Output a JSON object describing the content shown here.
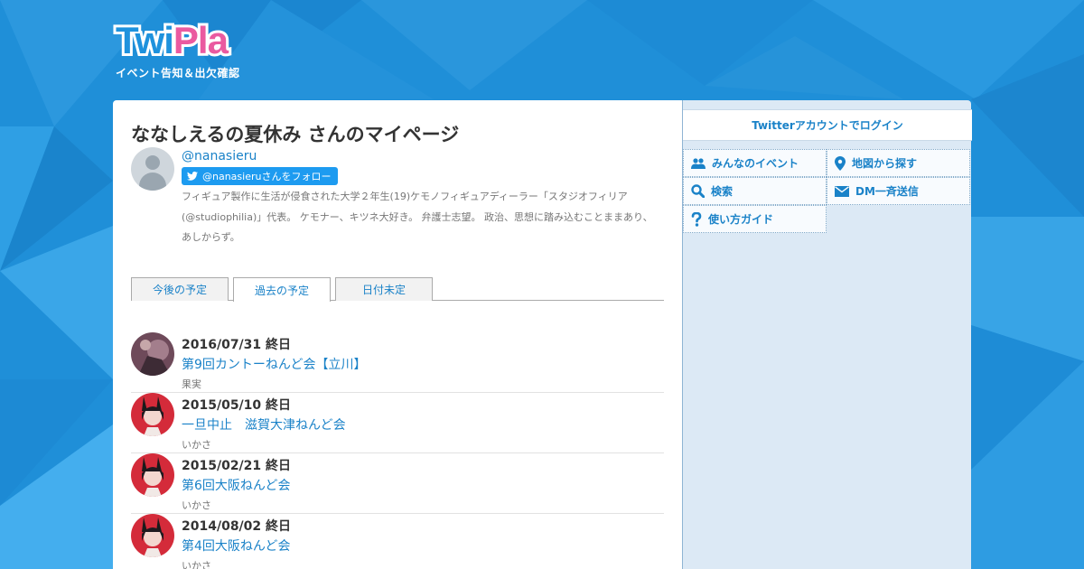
{
  "logo": {
    "word_twi": "Twi",
    "word_pla": "Pla",
    "tagline": "イベント告知＆出欠確認"
  },
  "profile": {
    "page_title": "ななしえるの夏休み さんのマイページ",
    "handle": "@nanasieru",
    "follow_label": "@nanasieruさんをフォロー",
    "bio": "フィギュア製作に生活が侵食された大学２年生(19)ケモノフィギュアディーラー「スタジオフィリア(@studiophilia)」代表。 ケモナー、キツネ大好き。 弁護士志望。 政治、思想に踏み込むことままあり、あしからず。"
  },
  "tabs": [
    {
      "label": "今後の予定",
      "active": false
    },
    {
      "label": "過去の予定",
      "active": true
    },
    {
      "label": "日付未定",
      "active": false
    }
  ],
  "events": [
    {
      "date": "2016/07/31 終日",
      "title": "第9回カントーねんど会【立川】",
      "user": "果実"
    },
    {
      "date": "2015/05/10 終日",
      "title": "一旦中止　滋賀大津ねんど会",
      "user": "いかさ"
    },
    {
      "date": "2015/02/21 終日",
      "title": "第6回大阪ねんど会",
      "user": "いかさ"
    },
    {
      "date": "2014/08/02 終日",
      "title": "第4回大阪ねんど会",
      "user": "いかさ"
    }
  ],
  "sidebar": {
    "login_label": "Twitterアカウントでログイン",
    "menu": [
      {
        "label": "みんなのイベント",
        "icon": "users-icon"
      },
      {
        "label": "地図から探す",
        "icon": "map-pin-icon"
      },
      {
        "label": "検索",
        "icon": "search-icon"
      },
      {
        "label": "DM一斉送信",
        "icon": "envelope-icon"
      },
      {
        "label": "使い方ガイド",
        "icon": "question-icon"
      }
    ]
  },
  "colors": {
    "background": "#1f8fd8",
    "link": "#1a82c8",
    "twitter_button": "#1d9bf0",
    "logo_pink": "#ea5aa0",
    "sidebar_bg": "#dce9f5"
  }
}
